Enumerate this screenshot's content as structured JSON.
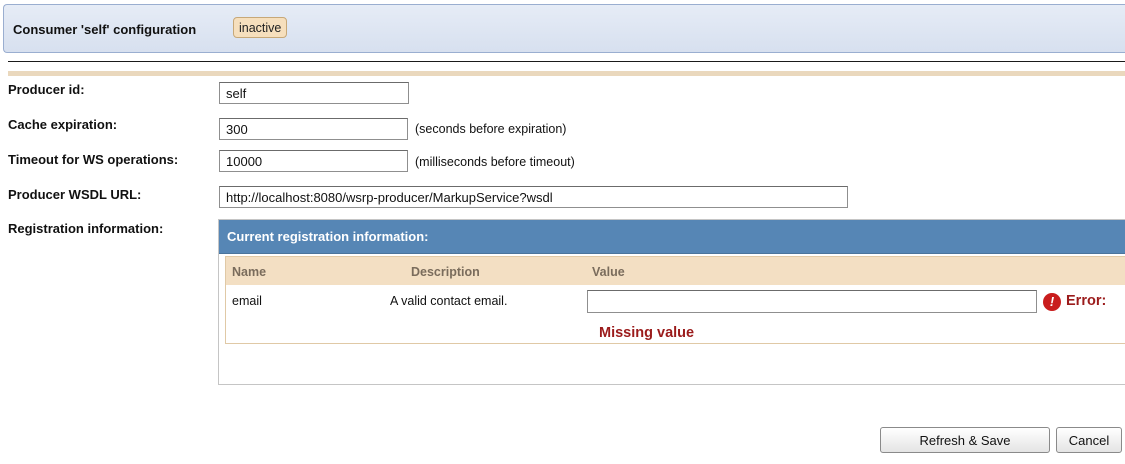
{
  "header": {
    "title": "Consumer 'self' configuration",
    "status_badge": "inactive"
  },
  "form": {
    "producer_id": {
      "label": "Producer id:",
      "value": "self"
    },
    "cache_expiration": {
      "label": "Cache expiration:",
      "value": "300",
      "hint": "(seconds before expiration)"
    },
    "timeout": {
      "label": "Timeout for WS operations:",
      "value": "10000",
      "hint": "(milliseconds before timeout)"
    },
    "wsdl_url": {
      "label": "Producer WSDL URL:",
      "value": "http://localhost:8080/wsrp-producer/MarkupService?wsdl"
    },
    "registration_label": "Registration information:"
  },
  "registration": {
    "title": "Current registration information:",
    "columns": [
      "Name",
      "Description",
      "Value"
    ],
    "rows": [
      {
        "name": "email",
        "description": "A valid contact email.",
        "value": ""
      }
    ],
    "error_label": "Error:",
    "error_message": "Missing value"
  },
  "buttons": {
    "refresh_save": "Refresh & Save",
    "cancel": "Cancel"
  },
  "colors": {
    "header_bg": "#dde5f2",
    "badge_bg": "#f6dfbd",
    "section_title_bg": "#5686b5",
    "table_head_bg": "#f3dfc3",
    "error_red": "#9b1b1b"
  },
  "icons": {
    "error": "exclamation-circle-icon"
  }
}
